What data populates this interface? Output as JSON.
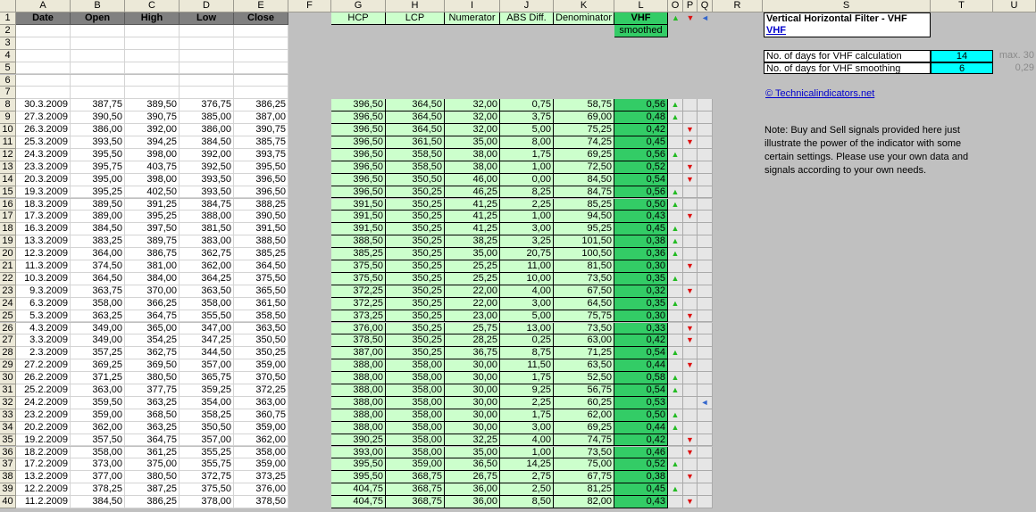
{
  "columns": [
    "A",
    "B",
    "C",
    "D",
    "E",
    "F",
    "G",
    "H",
    "I",
    "J",
    "K",
    "L",
    "O",
    "P",
    "Q",
    "R",
    "S",
    "T",
    "U"
  ],
  "row_numbers": [
    "1",
    "2",
    "3",
    "4",
    "5",
    "6",
    "7",
    "8",
    "9",
    "10",
    "11",
    "12",
    "13",
    "14",
    "15",
    "16",
    "17",
    "18",
    "19",
    "20",
    "21",
    "22",
    "23",
    "24",
    "25",
    "26",
    "27",
    "28",
    "29",
    "30",
    "31",
    "32",
    "33",
    "34",
    "35",
    "36",
    "37",
    "38",
    "39",
    "40"
  ],
  "price_headers": [
    "Date",
    "Open",
    "High",
    "Low",
    "Close"
  ],
  "calc_headers": [
    "HCP",
    "LCP",
    "Numerator",
    "ABS Diff.",
    "Denominator"
  ],
  "vhf_header": "VHF",
  "vhf_sub": "smoothed",
  "signal_headers": [
    "▲",
    "▼",
    "◄"
  ],
  "panel": {
    "title": "Vertical Horizontal Filter - VHF",
    "link": "VHF",
    "calc_label": "No. of days for VHF calculation",
    "calc_value": "14",
    "calc_hint": "max. 30",
    "smooth_label": "No. of days for VHF smoothing",
    "smooth_value": "6",
    "smooth_hint": "0,29",
    "site": "© Technicalindicators.net",
    "note": "Note: Buy and Sell signals provided here just illustrate the power of the indicator with some certain settings. Please use your own data and signals according to your own needs."
  },
  "rows": [
    [
      "30.3.2009",
      "387,75",
      "389,50",
      "376,75",
      "386,25",
      "396,50",
      "364,50",
      "32,00",
      "0,75",
      "58,75",
      "0,56",
      "up"
    ],
    [
      "27.3.2009",
      "390,50",
      "390,75",
      "385,00",
      "387,00",
      "396,50",
      "364,50",
      "32,00",
      "3,75",
      "69,00",
      "0,48",
      "up"
    ],
    [
      "26.3.2009",
      "386,00",
      "392,00",
      "386,00",
      "390,75",
      "396,50",
      "364,50",
      "32,00",
      "5,00",
      "75,25",
      "0,42",
      "down"
    ],
    [
      "25.3.2009",
      "393,50",
      "394,25",
      "384,50",
      "385,75",
      "396,50",
      "361,50",
      "35,00",
      "8,00",
      "74,25",
      "0,45",
      "down"
    ],
    [
      "24.3.2009",
      "395,50",
      "398,00",
      "392,00",
      "393,75",
      "396,50",
      "358,50",
      "38,00",
      "1,75",
      "69,25",
      "0,56",
      "up"
    ],
    [
      "23.3.2009",
      "395,75",
      "403,75",
      "392,50",
      "395,50",
      "396,50",
      "358,50",
      "38,00",
      "1,00",
      "72,50",
      "0,52",
      "down"
    ],
    [
      "20.3.2009",
      "395,00",
      "398,00",
      "393,50",
      "396,50",
      "396,50",
      "350,50",
      "46,00",
      "0,00",
      "84,50",
      "0,54",
      "down"
    ],
    [
      "19.3.2009",
      "395,25",
      "402,50",
      "393,50",
      "396,50",
      "396,50",
      "350,25",
      "46,25",
      "8,25",
      "84,75",
      "0,56",
      "up"
    ],
    [
      "18.3.2009",
      "389,50",
      "391,25",
      "384,75",
      "388,25",
      "391,50",
      "350,25",
      "41,25",
      "2,25",
      "85,25",
      "0,50",
      "up"
    ],
    [
      "17.3.2009",
      "389,00",
      "395,25",
      "388,00",
      "390,50",
      "391,50",
      "350,25",
      "41,25",
      "1,00",
      "94,50",
      "0,43",
      "down"
    ],
    [
      "16.3.2009",
      "384,50",
      "397,50",
      "381,50",
      "391,50",
      "391,50",
      "350,25",
      "41,25",
      "3,00",
      "95,25",
      "0,45",
      "up"
    ],
    [
      "13.3.2009",
      "383,25",
      "389,75",
      "383,00",
      "388,50",
      "388,50",
      "350,25",
      "38,25",
      "3,25",
      "101,50",
      "0,38",
      "up"
    ],
    [
      "12.3.2009",
      "364,00",
      "386,75",
      "362,75",
      "385,25",
      "385,25",
      "350,25",
      "35,00",
      "20,75",
      "100,50",
      "0,36",
      "up"
    ],
    [
      "11.3.2009",
      "374,50",
      "381,00",
      "362,00",
      "364,50",
      "375,50",
      "350,25",
      "25,25",
      "11,00",
      "81,50",
      "0,30",
      "down"
    ],
    [
      "10.3.2009",
      "364,50",
      "384,00",
      "364,25",
      "375,50",
      "375,50",
      "350,25",
      "25,25",
      "10,00",
      "73,50",
      "0,35",
      "up"
    ],
    [
      "9.3.2009",
      "363,75",
      "370,00",
      "363,50",
      "365,50",
      "372,25",
      "350,25",
      "22,00",
      "4,00",
      "67,50",
      "0,32",
      "down"
    ],
    [
      "6.3.2009",
      "358,00",
      "366,25",
      "358,00",
      "361,50",
      "372,25",
      "350,25",
      "22,00",
      "3,00",
      "64,50",
      "0,35",
      "up"
    ],
    [
      "5.3.2009",
      "363,25",
      "364,75",
      "355,50",
      "358,50",
      "373,25",
      "350,25",
      "23,00",
      "5,00",
      "75,75",
      "0,30",
      "down"
    ],
    [
      "4.3.2009",
      "349,00",
      "365,00",
      "347,00",
      "363,50",
      "376,00",
      "350,25",
      "25,75",
      "13,00",
      "73,50",
      "0,33",
      "down"
    ],
    [
      "3.3.2009",
      "349,00",
      "354,25",
      "347,25",
      "350,50",
      "378,50",
      "350,25",
      "28,25",
      "0,25",
      "63,00",
      "0,42",
      "down"
    ],
    [
      "2.3.2009",
      "357,25",
      "362,75",
      "344,50",
      "350,25",
      "387,00",
      "350,25",
      "36,75",
      "8,75",
      "71,25",
      "0,54",
      "up"
    ],
    [
      "27.2.2009",
      "369,25",
      "369,50",
      "357,00",
      "359,00",
      "388,00",
      "358,00",
      "30,00",
      "11,50",
      "63,50",
      "0,44",
      "down"
    ],
    [
      "26.2.2009",
      "371,25",
      "380,50",
      "365,75",
      "370,50",
      "388,00",
      "358,00",
      "30,00",
      "1,75",
      "52,50",
      "0,58",
      "up"
    ],
    [
      "25.2.2009",
      "363,00",
      "377,75",
      "359,25",
      "372,25",
      "388,00",
      "358,00",
      "30,00",
      "9,25",
      "56,75",
      "0,54",
      "up"
    ],
    [
      "24.2.2009",
      "359,50",
      "363,25",
      "354,00",
      "363,00",
      "388,00",
      "358,00",
      "30,00",
      "2,25",
      "60,25",
      "0,53",
      "left"
    ],
    [
      "23.2.2009",
      "359,00",
      "368,50",
      "358,25",
      "360,75",
      "388,00",
      "358,00",
      "30,00",
      "1,75",
      "62,00",
      "0,50",
      "up"
    ],
    [
      "20.2.2009",
      "362,00",
      "363,25",
      "350,50",
      "359,00",
      "388,00",
      "358,00",
      "30,00",
      "3,00",
      "69,25",
      "0,44",
      "up"
    ],
    [
      "19.2.2009",
      "357,50",
      "364,75",
      "357,00",
      "362,00",
      "390,25",
      "358,00",
      "32,25",
      "4,00",
      "74,75",
      "0,42",
      "down"
    ],
    [
      "18.2.2009",
      "358,00",
      "361,25",
      "355,25",
      "358,00",
      "393,00",
      "358,00",
      "35,00",
      "1,00",
      "73,50",
      "0,46",
      "down"
    ],
    [
      "17.2.2009",
      "373,00",
      "375,00",
      "355,75",
      "359,00",
      "395,50",
      "359,00",
      "36,50",
      "14,25",
      "75,00",
      "0,52",
      "up"
    ],
    [
      "13.2.2009",
      "377,00",
      "380,50",
      "372,75",
      "373,25",
      "395,50",
      "368,75",
      "26,75",
      "2,75",
      "67,75",
      "0,38",
      "down"
    ],
    [
      "12.2.2009",
      "378,25",
      "387,25",
      "375,50",
      "376,00",
      "404,75",
      "368,75",
      "36,00",
      "2,50",
      "81,25",
      "0,45",
      "up"
    ],
    [
      "11.2.2009",
      "384,50",
      "386,25",
      "378,00",
      "378,50",
      "404,75",
      "368,75",
      "36,00",
      "8,50",
      "82,00",
      "0,43",
      "down"
    ]
  ]
}
